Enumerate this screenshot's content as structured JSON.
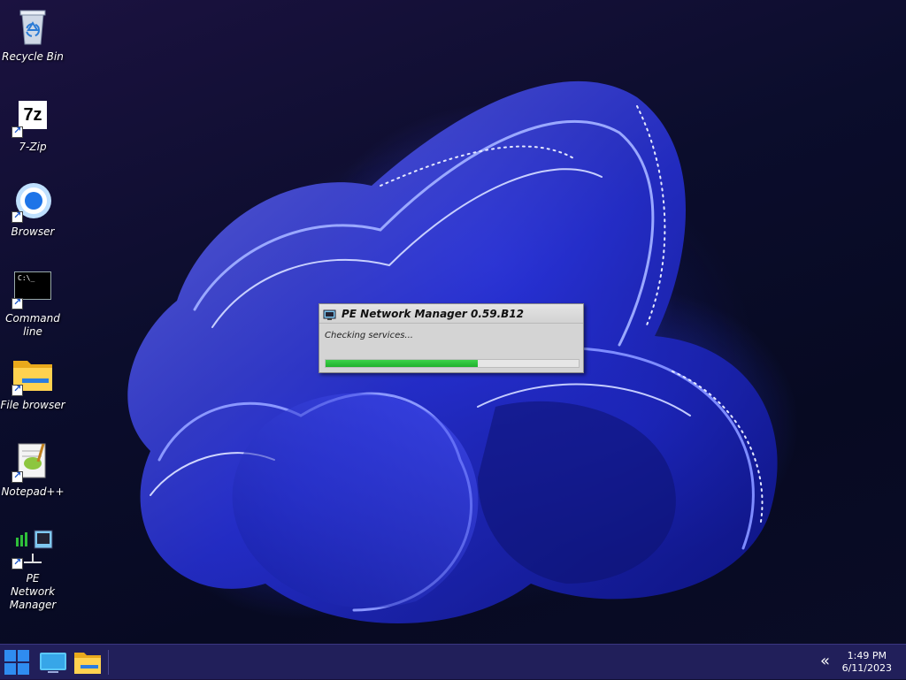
{
  "desktop": {
    "icons": [
      {
        "label": "Recycle Bin",
        "icon": "recycle-bin-icon"
      },
      {
        "label": "7-Zip",
        "icon": "7zip-icon"
      },
      {
        "label": "Browser",
        "icon": "browser-icon"
      },
      {
        "label": "Command line",
        "icon": "terminal-icon"
      },
      {
        "label": "File browser",
        "icon": "folder-icon"
      },
      {
        "label": "Notepad++",
        "icon": "notepad-icon"
      },
      {
        "label": "PE Network Manager",
        "icon": "network-manager-icon"
      }
    ],
    "sevenzip_glyph": "7z",
    "terminal_prompt": "C:\\_"
  },
  "dialog": {
    "title": "PE Network Manager 0.59.B12",
    "status": "Checking services...",
    "progress": 0.6
  },
  "taskbar": {
    "start_icon": "windows-start-icon",
    "pinned": [
      "monitor-icon",
      "folder-icon"
    ],
    "tray_icon": "chevron-double-left-icon",
    "time": "1:49 PM",
    "date": "6/11/2023"
  },
  "colors": {
    "progress_fill": "#22b52f",
    "taskbar_bg": "#211f5a",
    "start_blue": "#2f8cf0"
  }
}
